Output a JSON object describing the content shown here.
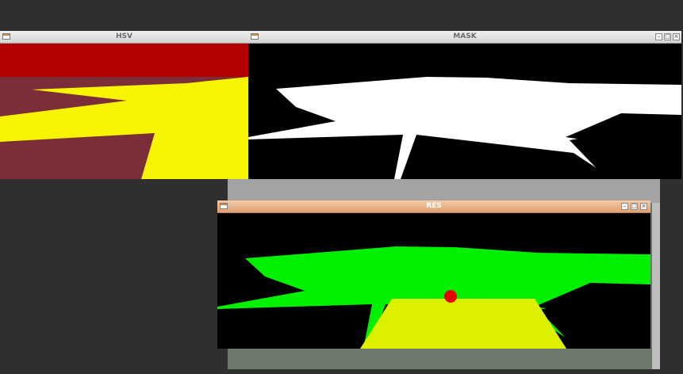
{
  "desktop": {
    "background": "#2f2f2f"
  },
  "windows": {
    "hsv": {
      "title": "HSV"
    },
    "mask": {
      "title": "MASK"
    },
    "res": {
      "title": "RES"
    }
  },
  "buttons": {
    "minimize": "–",
    "maximize": "□",
    "close": "×"
  },
  "colors": {
    "hsv_top": "#b30000",
    "hsv_bg": "#7b2e37",
    "hsv_shape": "#f7f400",
    "mask_bg": "#000000",
    "mask_shape": "#ffffff",
    "res_green": "#00f000",
    "res_yellow": "#ddf000",
    "centroid": "#e80000"
  }
}
